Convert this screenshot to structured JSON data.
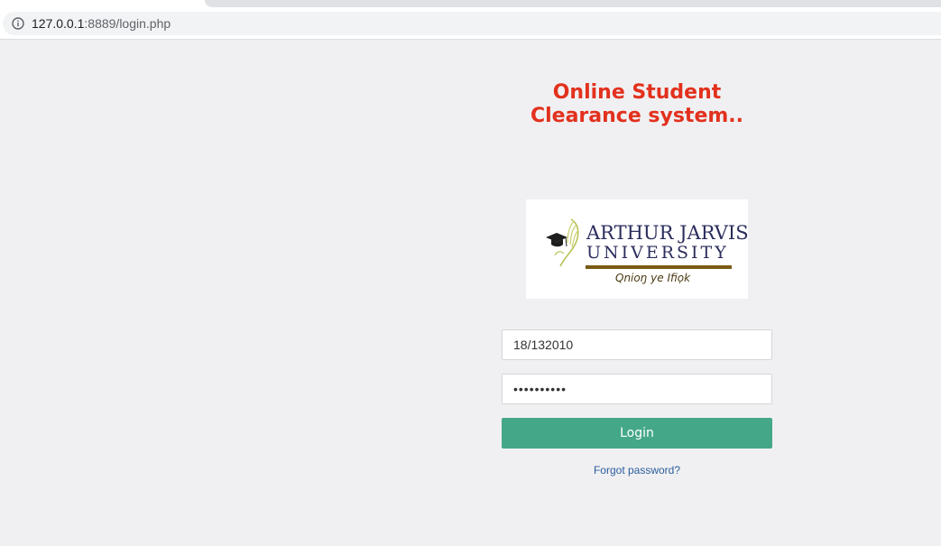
{
  "browser": {
    "url_host": "127.0.0.1",
    "url_rest": ":8889/login.php",
    "info_icon": "info-icon"
  },
  "page": {
    "title_line1": "Online Student",
    "title_line2": "Clearance system..",
    "title_color": "#e2311d",
    "logo": {
      "name_line1": "ARTHUR JARVIS",
      "name_line2": "UNIVERSITY",
      "motto": "Qnioŋ ye Ifiọk"
    },
    "form": {
      "username_value": "18/132010",
      "password_value": "••••••••••",
      "login_label": "Login",
      "button_color": "#44a888",
      "forgot_label": "Forgot password?"
    }
  }
}
